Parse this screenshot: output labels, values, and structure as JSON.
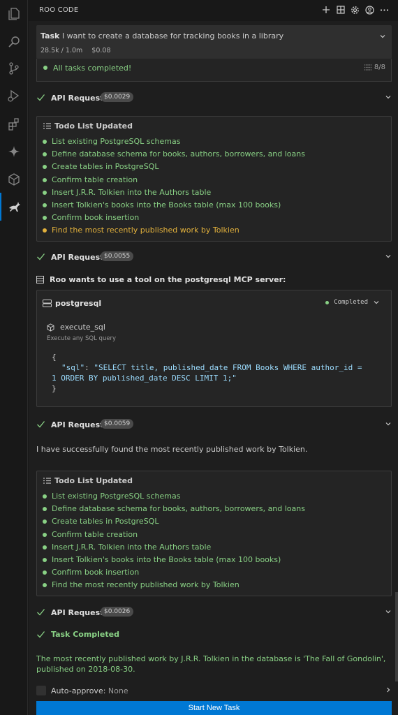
{
  "header": {
    "title": "ROO CODE",
    "icons": [
      "plus-icon",
      "history-grid-icon",
      "gear-icon",
      "account-icon",
      "more-icon"
    ]
  },
  "activity_bar": {
    "icons": [
      "explorer-icon",
      "search-icon",
      "source-control-icon",
      "run-debug-icon",
      "extensions-icon",
      "copilot-sparkle-icon",
      "cube-icon",
      "roo-kangaroo-icon"
    ],
    "active": "roo-kangaroo-icon"
  },
  "task": {
    "prefix": "Task",
    "text": "I want to create a database for tracking books in a library",
    "tokens": "28.5k / 1.0m",
    "cost": "$0.08",
    "status": "All tasks completed!",
    "progress": "8/8"
  },
  "api_requests": [
    {
      "label": "API Request",
      "cost": "$0.0029"
    },
    {
      "label": "API Request",
      "cost": "$0.0055"
    },
    {
      "label": "API Request",
      "cost": "$0.0059"
    },
    {
      "label": "API Request",
      "cost": "$0.0026"
    }
  ],
  "todo1": {
    "title": "Todo List Updated",
    "items": [
      {
        "text": "List existing PostgreSQL schemas",
        "status": "done"
      },
      {
        "text": "Define database schema for books, authors, borrowers, and loans",
        "status": "done"
      },
      {
        "text": "Create tables in PostgreSQL",
        "status": "done"
      },
      {
        "text": "Confirm table creation",
        "status": "done"
      },
      {
        "text": "Insert J.R.R. Tolkien into the Authors table",
        "status": "done"
      },
      {
        "text": "Insert Tolkien's books into the Books table (max 100 books)",
        "status": "done"
      },
      {
        "text": "Confirm book insertion",
        "status": "done"
      },
      {
        "text": "Find the most recently published work by Tolkien",
        "status": "pending"
      }
    ]
  },
  "mcp": {
    "intro": "Roo wants to use a tool on the postgresql MCP server:",
    "server": "postgresql",
    "status": "Completed",
    "tool": "execute_sql",
    "tool_desc": "Execute any SQL query",
    "code_open": "{",
    "code_key": "\"sql\"",
    "code_sep": ": ",
    "code_value_1": "\"SELECT title, published_date FROM Books WHERE author_id =",
    "code_value_2": "1 ORDER BY published_date DESC LIMIT 1;\"",
    "code_close": "}"
  },
  "message": "I have successfully found the most recently published work by Tolkien.",
  "todo2": {
    "title": "Todo List Updated",
    "items": [
      {
        "text": "List existing PostgreSQL schemas",
        "status": "done"
      },
      {
        "text": "Define database schema for books, authors, borrowers, and loans",
        "status": "done"
      },
      {
        "text": "Create tables in PostgreSQL",
        "status": "done"
      },
      {
        "text": "Confirm table creation",
        "status": "done"
      },
      {
        "text": "Insert J.R.R. Tolkien into the Authors table",
        "status": "done"
      },
      {
        "text": "Insert Tolkien's books into the Books table (max 100 books)",
        "status": "done"
      },
      {
        "text": "Confirm book insertion",
        "status": "done"
      },
      {
        "text": "Find the most recently published work by Tolkien",
        "status": "done"
      }
    ]
  },
  "completion": {
    "label": "Task Completed",
    "result": "The most recently published work by J.R.R. Tolkien in the database is 'The Fall of Gondolin', published on 2018-08-30."
  },
  "auto_approve": {
    "label": "Auto-approve:",
    "value": "None"
  },
  "start_button": "Start New Task",
  "colors": {
    "accent": "#0078d4",
    "success": "#89d185",
    "pending": "#e2b13c",
    "background": "#1e1e1e"
  }
}
